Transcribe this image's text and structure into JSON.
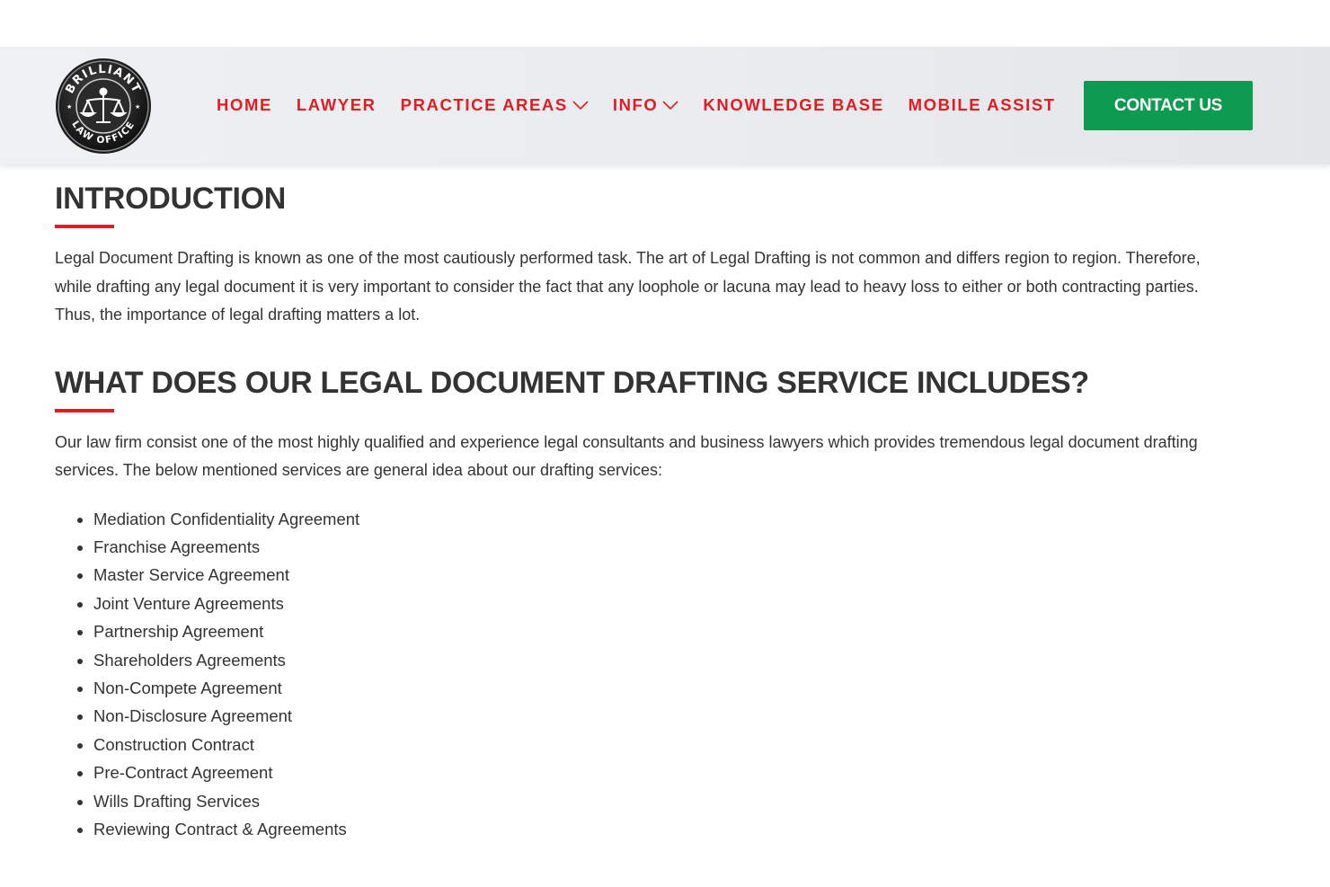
{
  "header": {
    "logo": {
      "icon": "scales-of-justice-icon",
      "text_top": "BRILLIANT",
      "text_bottom": "LAW OFFICE"
    },
    "nav": [
      {
        "label": "HOME",
        "has_dropdown": false
      },
      {
        "label": "LAWYER",
        "has_dropdown": false
      },
      {
        "label": "PRACTICE AREAS",
        "has_dropdown": true
      },
      {
        "label": "INFO",
        "has_dropdown": true
      },
      {
        "label": "KNOWLEDGE BASE",
        "has_dropdown": false
      },
      {
        "label": "MOBILE ASSIST",
        "has_dropdown": false
      }
    ],
    "contact_label": "CONTACT US"
  },
  "intro": {
    "heading": "INTRODUCTION",
    "body": "Legal Document Drafting is known as one of the most cautiously performed task. The art of Legal Drafting is not common and differs region to region. Therefore, while drafting any legal document it is very important to consider the fact that any loophole or lacuna may lead to heavy loss to either or both contracting parties. Thus, the importance of legal drafting matters a lot."
  },
  "services": {
    "heading": "WHAT DOES OUR LEGAL DOCUMENT DRAFTING SERVICE INCLUDES?",
    "body": "Our law firm consist one of the most highly qualified and experience legal consultants and business lawyers which provides tremendous legal document drafting services. The below mentioned services are general idea about our drafting services:",
    "items": [
      "Mediation Confidentiality Agreement",
      "Franchise Agreements",
      "Master Service Agreement",
      "Joint Venture Agreements",
      "Partnership Agreement",
      "Shareholders Agreements",
      "Non-Compete Agreement",
      "Non-Disclosure Agreement",
      "Construction Contract",
      "Pre-Contract Agreement",
      "Wills Drafting Services",
      "Reviewing Contract & Agreements"
    ]
  },
  "colors": {
    "accent": "#e31b23",
    "button": "#0e9a50",
    "text": "#333333"
  }
}
